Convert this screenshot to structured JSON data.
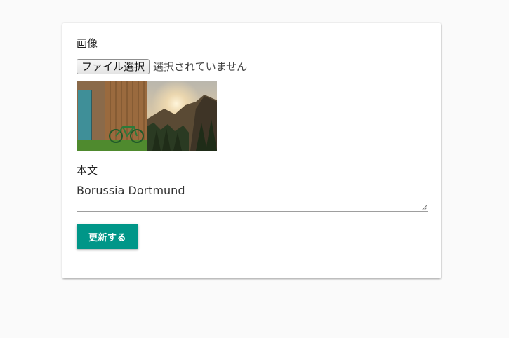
{
  "form": {
    "image_label": "画像",
    "file_input": {
      "button_label": "ファイル選択",
      "status_text": "選択されていません"
    },
    "thumbnails": [
      {
        "subject": "wooden-shed-with-bicycle"
      },
      {
        "subject": "mountain-forest-sunset"
      }
    ],
    "body_label": "本文",
    "body_value": "Borussia Dortmund",
    "submit_label": "更新する"
  },
  "colors": {
    "background": "#fafafa",
    "card": "#ffffff",
    "accent": "#009688"
  }
}
